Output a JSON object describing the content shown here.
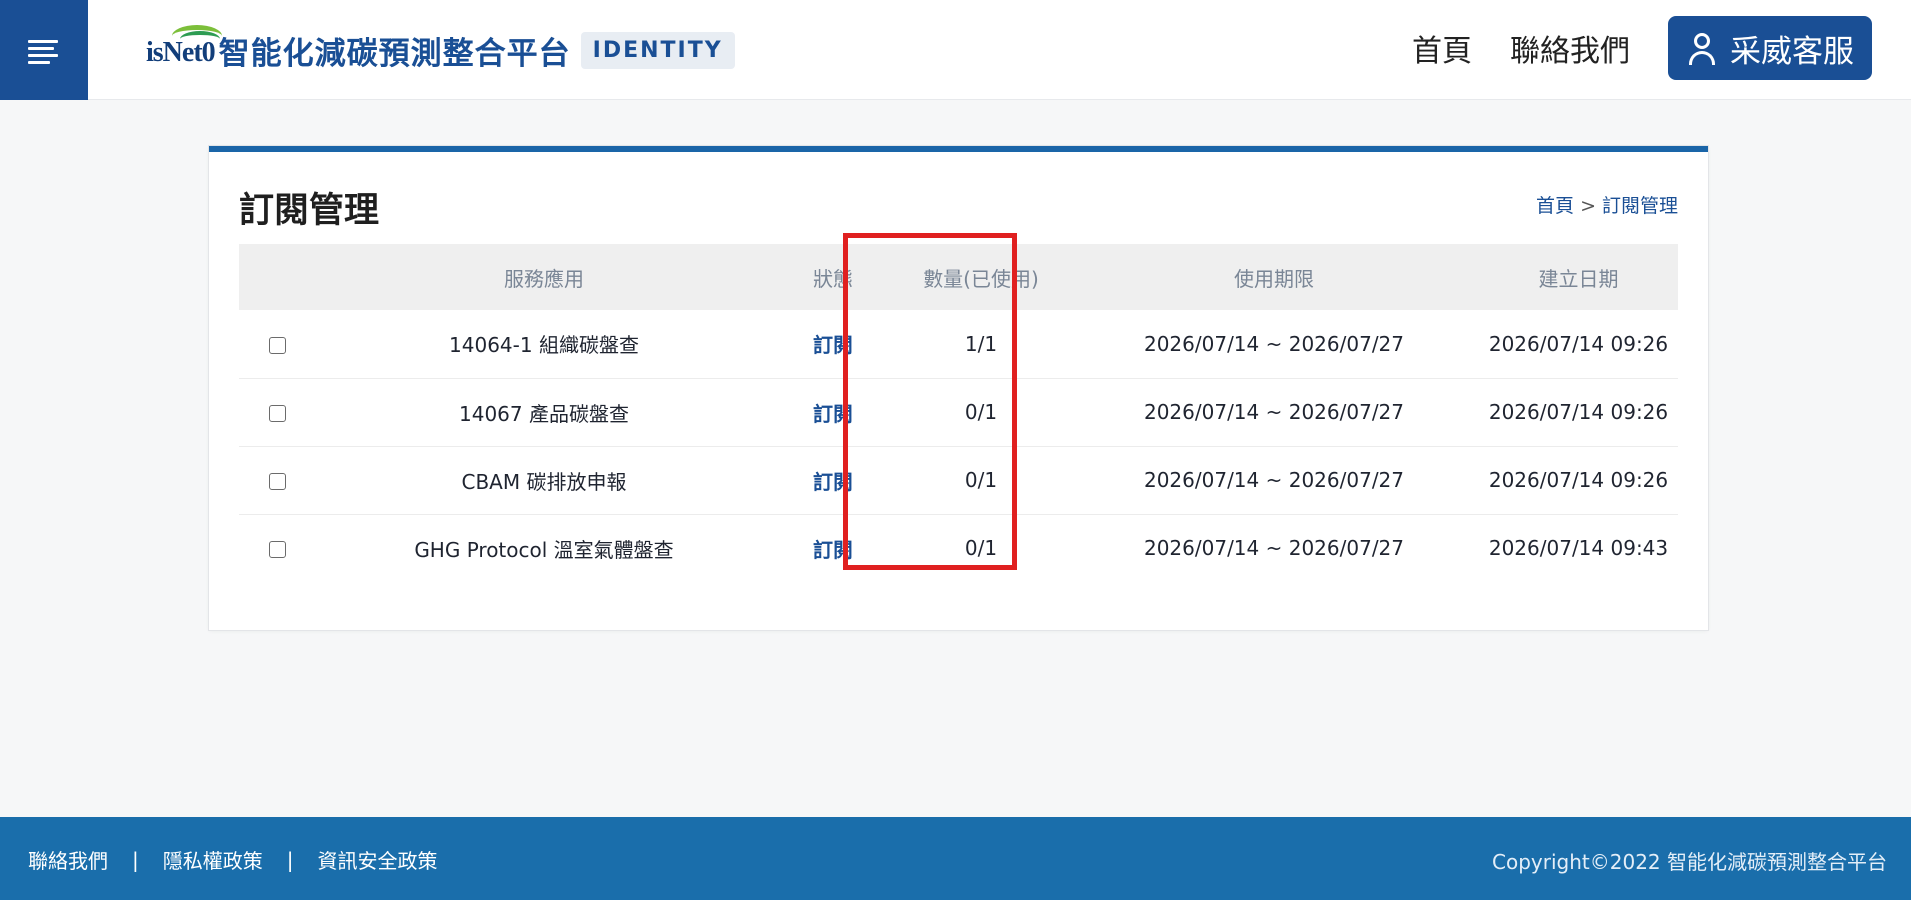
{
  "header": {
    "logo_text": "isNet0",
    "brand_title": "智能化減碳預測整合平台",
    "brand_badge": "IDENTITY",
    "nav_home": "首頁",
    "nav_contact": "聯絡我們",
    "service_label": "采威客服",
    "menu_icon": "hamburger-menu-icon",
    "service_icon": "user-icon"
  },
  "page": {
    "title": "訂閱管理",
    "breadcrumb": {
      "home": "首頁",
      "separator": ">",
      "current": "訂閱管理"
    }
  },
  "table": {
    "headers": [
      "",
      "服務應用",
      "狀態",
      "數量(已使用)",
      "使用期限",
      "建立日期"
    ],
    "rows": [
      {
        "service": "14064-1 組織碳盤查",
        "status": "訂閱",
        "quantity": "1/1",
        "period": "2026/07/14 ~ 2026/07/27",
        "created": "2026/07/14 09:26"
      },
      {
        "service": "14067 產品碳盤查",
        "status": "訂閱",
        "quantity": "0/1",
        "period": "2026/07/14 ~ 2026/07/27",
        "created": "2026/07/14 09:26"
      },
      {
        "service": "CBAM 碳排放申報",
        "status": "訂閱",
        "quantity": "0/1",
        "period": "2026/07/14 ~ 2026/07/27",
        "created": "2026/07/14 09:26"
      },
      {
        "service": "GHG Protocol 溫室氣體盤查",
        "status": "訂閱",
        "quantity": "0/1",
        "period": "2026/07/14 ~ 2026/07/27",
        "created": "2026/07/14 09:43"
      }
    ]
  },
  "footer": {
    "contact": "聯絡我們",
    "privacy": "隱私權政策",
    "security": "資訊安全政策",
    "divider": "|",
    "copyright": "Copyright©2022 智能化減碳預測整合平台"
  },
  "colors": {
    "primary": "#1a4f95",
    "footer": "#1a6eab",
    "card_accent": "#1a65a8",
    "highlight": "#e02020"
  }
}
